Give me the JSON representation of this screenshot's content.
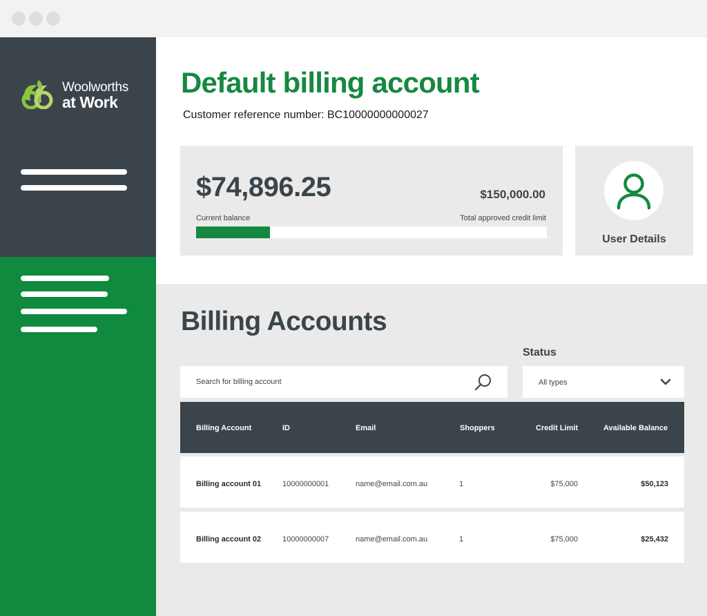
{
  "app": {
    "brand_line1": "Woolworths",
    "brand_line2": "at Work"
  },
  "header": {
    "title": "Default billing account",
    "customer_reference": "Customer reference number: BC10000000000027"
  },
  "balance": {
    "current_amount": "$74,896.25",
    "current_label": "Current balance",
    "limit_amount": "$150,000.00",
    "limit_label": "Total approved credit limit",
    "progress_fraction": 0.21
  },
  "user_card": {
    "label": "User Details",
    "icon": "user-icon"
  },
  "billing": {
    "section_title": "Billing Accounts",
    "search_placeholder": "Search for billing account",
    "status_label": "Status",
    "status_value": "All types",
    "columns": [
      "Billing Account",
      "ID",
      "Email",
      "Shoppers",
      "Credit Limit",
      "Available Balance"
    ],
    "rows": [
      {
        "name": "Billing account 01",
        "id": "10000000001",
        "email": "name@email.com.au",
        "shoppers": "1",
        "credit_limit": "$75,000",
        "available_balance": "$50,123"
      },
      {
        "name": "Billing account 02",
        "id": "10000000007",
        "email": "name@email.com.au",
        "shoppers": "1",
        "credit_limit": "$75,000",
        "available_balance": "$25,432"
      }
    ]
  },
  "colors": {
    "brand_green": "#178841",
    "sidebar_green": "#0f8a3e",
    "dark_slate": "#3b444b",
    "panel_grey": "#e9eae9"
  }
}
